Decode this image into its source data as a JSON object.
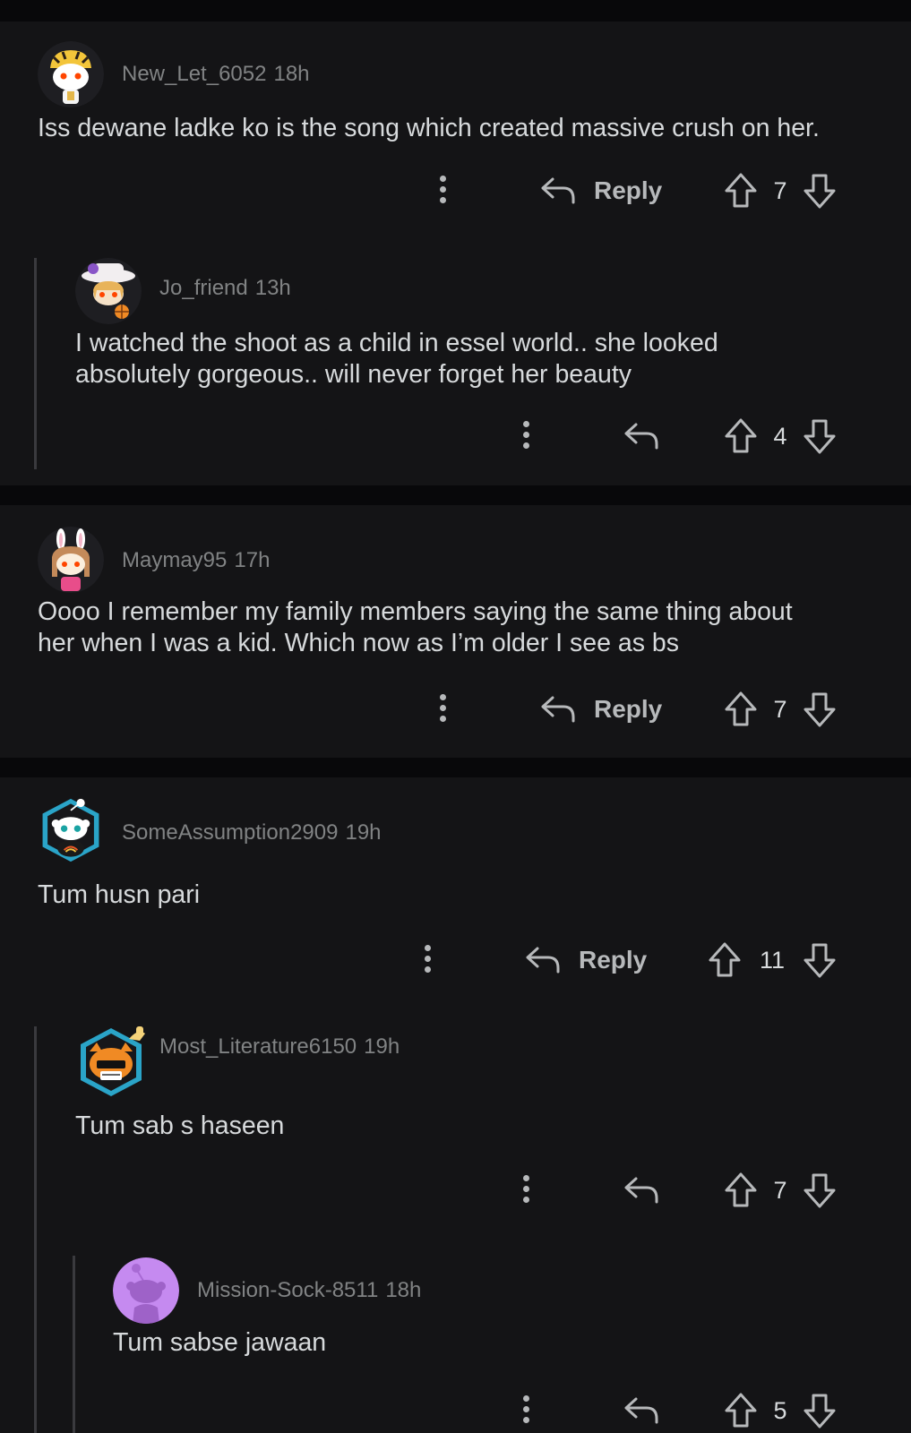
{
  "comments": [
    {
      "username": "New_Let_6052",
      "time": "18h",
      "text": "Iss dewane ladke ko is the song which created massive crush on her.",
      "reply_label": "Reply",
      "score": "7",
      "avatar": "snoo-tiger-avatar-icon"
    },
    {
      "username": "Jo_friend",
      "time": "13h",
      "text": "I watched the shoot as a child in essel world.. she looked\nabsolutely gorgeous.. will never forget her beauty",
      "score": "4",
      "avatar": "snoo-hat-avatar-icon"
    },
    {
      "username": "Maymay95",
      "time": "17h",
      "text": "Oooo I remember my family members saying the same thing about\nher when I was a kid. Which now as I’m older I see as bs",
      "reply_label": "Reply",
      "score": "7",
      "avatar": "snoo-bunny-avatar-icon"
    },
    {
      "username": "SomeAssumption2909",
      "time": "19h",
      "text": "Tum husn pari",
      "reply_label": "Reply",
      "score": "11",
      "avatar": "snoo-nft-avatar-icon"
    },
    {
      "username": "Most_Literature6150",
      "time": "19h",
      "text": "Tum sab s haseen",
      "score": "7",
      "avatar": "snoo-cat-nft-avatar-icon"
    },
    {
      "username": "Mission-Sock-8511",
      "time": "18h",
      "text": "Tum sabse jawaan",
      "score": "5",
      "avatar": "snoo-default-purple-avatar-icon"
    }
  ],
  "colors": {
    "background": "#141416",
    "divider": "#08080a",
    "muted_text": "#818384",
    "body_text": "#d7dadc"
  }
}
